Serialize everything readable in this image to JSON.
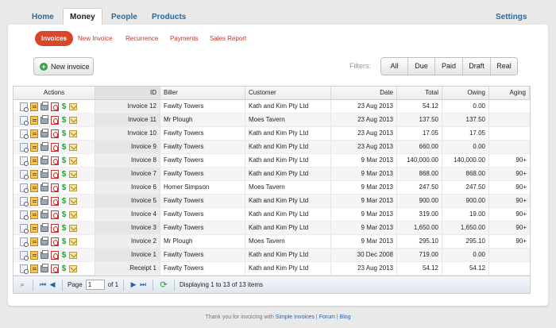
{
  "topnav": {
    "tabs": [
      {
        "label": "Home"
      },
      {
        "label": "Money"
      },
      {
        "label": "People"
      },
      {
        "label": "Products"
      }
    ],
    "settings": "Settings"
  },
  "subnav": [
    "Invoices",
    "New Invoice",
    "Recurrence",
    "Payments",
    "Sales Report"
  ],
  "toolbar": {
    "new_invoice": "New invoice",
    "filters_label": "Filters:",
    "filters": [
      "All",
      "Due",
      "Paid",
      "Draft",
      "Real"
    ]
  },
  "table": {
    "columns": [
      "Actions",
      "ID",
      "Biller",
      "Customer",
      "Date",
      "Total",
      "Owing",
      "Aging"
    ],
    "rows": [
      {
        "id": "Invoice 12",
        "biller": "Fawlty Towers",
        "customer": "Kath and Kim Pty Ltd",
        "date": "23 Aug 2013",
        "total": "54.12",
        "owing": "0.00",
        "aging": ""
      },
      {
        "id": "Invoice 11",
        "biller": "Mr Plough",
        "customer": "Moes Tavern",
        "date": "23 Aug 2013",
        "total": "137.50",
        "owing": "137.50",
        "aging": ""
      },
      {
        "id": "Invoice 10",
        "biller": "Fawlty Towers",
        "customer": "Kath and Kim Pty Ltd",
        "date": "23 Aug 2013",
        "total": "17.05",
        "owing": "17.05",
        "aging": ""
      },
      {
        "id": "Invoice 9",
        "biller": "Fawlty Towers",
        "customer": "Kath and Kim Pty Ltd",
        "date": "23 Aug 2013",
        "total": "660.00",
        "owing": "0.00",
        "aging": ""
      },
      {
        "id": "Invoice 8",
        "biller": "Fawlty Towers",
        "customer": "Kath and Kim Pty Ltd",
        "date": "9 Mar 2013",
        "total": "140,000.00",
        "owing": "140,000.00",
        "aging": "90+"
      },
      {
        "id": "Invoice 7",
        "biller": "Fawlty Towers",
        "customer": "Kath and Kim Pty Ltd",
        "date": "9 Mar 2013",
        "total": "868.00",
        "owing": "868.00",
        "aging": "90+"
      },
      {
        "id": "Invoice 6",
        "biller": "Homer Simpson",
        "customer": "Moes Tavern",
        "date": "9 Mar 2013",
        "total": "247.50",
        "owing": "247.50",
        "aging": "90+"
      },
      {
        "id": "Invoice 5",
        "biller": "Fawlty Towers",
        "customer": "Kath and Kim Pty Ltd",
        "date": "9 Mar 2013",
        "total": "900.00",
        "owing": "900.00",
        "aging": "90+"
      },
      {
        "id": "Invoice 4",
        "biller": "Fawlty Towers",
        "customer": "Kath and Kim Pty Ltd",
        "date": "9 Mar 2013",
        "total": "319.00",
        "owing": "19.00",
        "aging": "90+"
      },
      {
        "id": "Invoice 3",
        "biller": "Fawlty Towers",
        "customer": "Kath and Kim Pty Ltd",
        "date": "9 Mar 2013",
        "total": "1,650.00",
        "owing": "1,650.00",
        "aging": "90+"
      },
      {
        "id": "Invoice 2",
        "biller": "Mr Plough",
        "customer": "Moes Tavern",
        "date": "9 Mar 2013",
        "total": "295.10",
        "owing": "295.10",
        "aging": "90+"
      },
      {
        "id": "Invoice 1",
        "biller": "Fawlty Towers",
        "customer": "Kath and Kim Pty Ltd",
        "date": "30 Dec 2008",
        "total": "719.00",
        "owing": "0.00",
        "aging": ""
      },
      {
        "id": "Receipt 1",
        "biller": "Fawlty Towers",
        "customer": "Kath and Kim Pty Ltd",
        "date": "23 Aug 2013",
        "total": "54.12",
        "owing": "54.12",
        "aging": ""
      }
    ]
  },
  "pager": {
    "page_label": "Page",
    "page_value": "1",
    "of_label": "of 1",
    "status": "Displaying 1 to 13 of 13 items"
  },
  "footer": {
    "prefix": "Thank you for invoicing with",
    "app": "Simple Invoices",
    "sep1": "|",
    "forum": "Forum",
    "sep2": "|",
    "blog": "Blog"
  },
  "colors": {
    "accent": "#d9472b",
    "link": "#2a6a9e"
  }
}
